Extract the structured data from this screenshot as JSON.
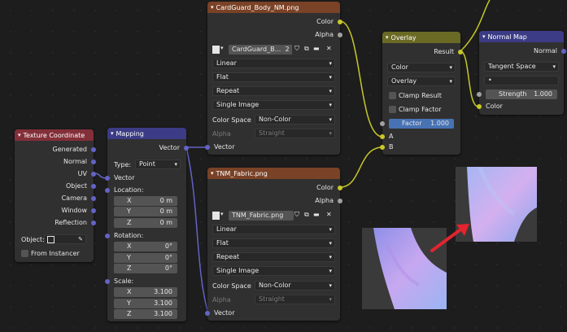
{
  "nodes": {
    "tex1": {
      "title": "CardGuard_Body_NM.png",
      "out_color": "Color",
      "out_alpha": "Alpha",
      "image_name": "CardGuard_B...",
      "users": "2",
      "interpolation": "Linear",
      "projection": "Flat",
      "extension": "Repeat",
      "source": "Single Image",
      "color_space_label": "Color Space",
      "color_space": "Non-Color",
      "alpha_label": "Alpha",
      "alpha": "Straight",
      "in_vector": "Vector"
    },
    "tex2": {
      "title": "TNM_Fabric.png",
      "out_color": "Color",
      "out_alpha": "Alpha",
      "image_name": "TNM_Fabric.png",
      "interpolation": "Linear",
      "projection": "Flat",
      "extension": "Repeat",
      "source": "Single Image",
      "color_space_label": "Color Space",
      "color_space": "Non-Color",
      "alpha_label": "Alpha",
      "alpha": "Straight",
      "in_vector": "Vector"
    },
    "overlay": {
      "title": "Overlay",
      "out_result": "Result",
      "type": "Color",
      "blend": "Overlay",
      "clamp_result": "Clamp Result",
      "clamp_factor": "Clamp Factor",
      "factor_label": "Factor",
      "factor": "1.000",
      "in_a": "A",
      "in_b": "B"
    },
    "normal_map": {
      "title": "Normal Map",
      "out_normal": "Normal",
      "space": "Tangent Space",
      "uv_value": "•",
      "strength_label": "Strength",
      "strength": "1.000",
      "in_color": "Color"
    },
    "texcoord": {
      "title": "Texture Coordinate",
      "outputs": [
        "Generated",
        "Normal",
        "UV",
        "Object",
        "Camera",
        "Window",
        "Reflection"
      ],
      "object_label": "Object:",
      "from_instancer": "From Instancer"
    },
    "mapping": {
      "title": "Mapping",
      "out_vector": "Vector",
      "type_label": "Type:",
      "type": "Point",
      "in_vector": "Vector",
      "location_label": "Location:",
      "rotation_label": "Rotation:",
      "scale_label": "Scale:",
      "location": [
        {
          "axis": "X",
          "value": "0 m"
        },
        {
          "axis": "Y",
          "value": "0 m"
        },
        {
          "axis": "Z",
          "value": "0 m"
        }
      ],
      "rotation": [
        {
          "axis": "X",
          "value": "0°"
        },
        {
          "axis": "Y",
          "value": "0°"
        },
        {
          "axis": "Z",
          "value": "0°"
        }
      ],
      "scale": [
        {
          "axis": "X",
          "value": "3.100"
        },
        {
          "axis": "Y",
          "value": "3.100"
        },
        {
          "axis": "Z",
          "value": "3.100"
        }
      ]
    }
  },
  "colors": {
    "image_socket": "#c7c729",
    "vector_socket": "#6363c7",
    "float_socket": "#a1a1a1",
    "annotation_arrow": "#e0252f"
  }
}
